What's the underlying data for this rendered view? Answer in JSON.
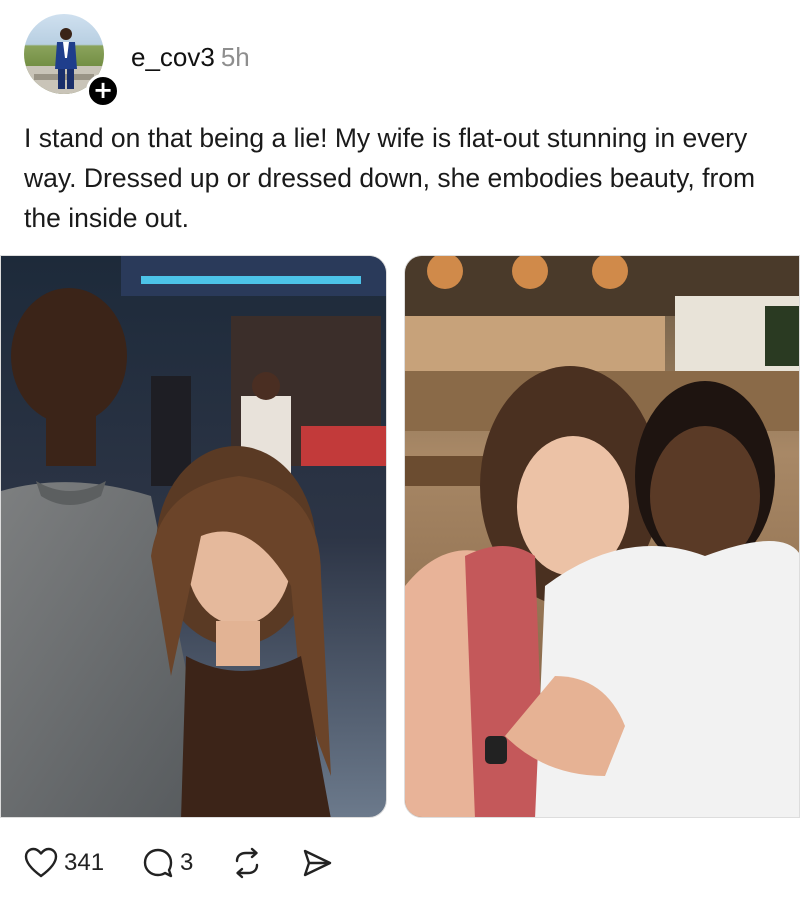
{
  "post": {
    "username": "e_cov3",
    "timestamp": "5h",
    "follow_label": "+",
    "text": "I stand on that being a lie! My wife is flat-out stunning in every way. Dressed up or dressed down, she embodies beauty, from the inside out."
  },
  "actions": {
    "like_count": "341",
    "reply_count": "3"
  },
  "icons": {
    "like": "heart-icon",
    "reply": "comment-icon",
    "repost": "repost-icon",
    "share": "send-icon",
    "follow": "plus-icon"
  },
  "colors": {
    "text": "#1a1a1a",
    "timestamp": "#8e8e8e",
    "follow_button": "#000000"
  }
}
